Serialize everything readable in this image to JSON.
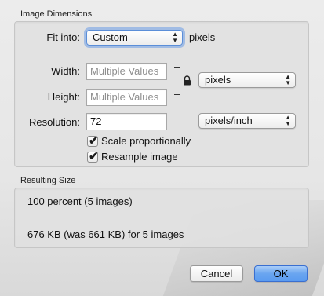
{
  "image_dimensions": {
    "section_title": "Image Dimensions",
    "fit_into": {
      "label": "Fit into:",
      "value": "Custom",
      "unit": "pixels"
    },
    "width": {
      "label": "Width:",
      "placeholder": "Multiple Values"
    },
    "height": {
      "label": "Height:",
      "placeholder": "Multiple Values"
    },
    "size_units": {
      "value": "pixels"
    },
    "resolution": {
      "label": "Resolution:",
      "value": "72",
      "units_value": "pixels/inch"
    },
    "scale_proportionally": {
      "label": "Scale proportionally",
      "checked": true
    },
    "resample_image": {
      "label": "Resample image",
      "checked": true
    }
  },
  "resulting_size": {
    "section_title": "Resulting Size",
    "percent_text": "100 percent (5 images)",
    "size_text": "676 KB (was 661 KB) for 5 images"
  },
  "buttons": {
    "cancel": "Cancel",
    "ok": "OK"
  },
  "icons": {
    "lock": "lock-icon",
    "popup_arrows": "updown-chevron-icon",
    "checkmark": "checkmark-icon"
  },
  "colors": {
    "focus_ring": "#6c9ce6",
    "default_button": "#5a9bf0"
  }
}
